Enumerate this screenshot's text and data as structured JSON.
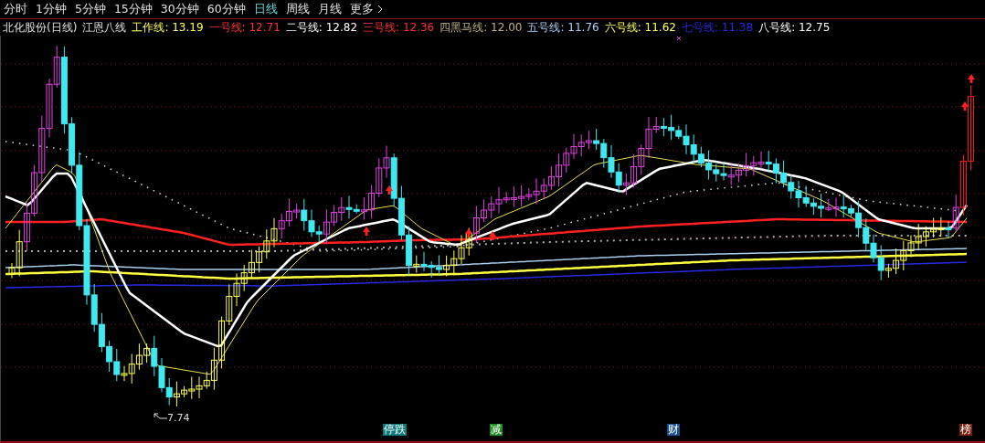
{
  "periods": [
    {
      "label": "分时",
      "selected": false
    },
    {
      "label": "1分钟",
      "selected": false
    },
    {
      "label": "5分钟",
      "selected": false
    },
    {
      "label": "15分钟",
      "selected": false
    },
    {
      "label": "30分钟",
      "selected": false
    },
    {
      "label": "60分钟",
      "selected": false
    },
    {
      "label": "日线",
      "selected": true
    },
    {
      "label": "周线",
      "selected": false
    },
    {
      "label": "月线",
      "selected": false
    },
    {
      "label": "更多",
      "selected": false
    }
  ],
  "legend": {
    "stock": "北化股份(日线)",
    "indicator": "江恩八线",
    "lines": [
      {
        "label": "工作线: 13.19",
        "color": "#ffff54"
      },
      {
        "label": "一号线: 12.71",
        "color": "#ff3030"
      },
      {
        "label": "二号线: 12.82",
        "color": "#ffffff"
      },
      {
        "label": "三号线: 12.36",
        "color": "#ff3030"
      },
      {
        "label": "四黑马线: 12.00",
        "color": "#c0b080"
      },
      {
        "label": "五号线: 11.76",
        "color": "#a8d0f0"
      },
      {
        "label": "六号线: 11.62",
        "color": "#ffff54"
      },
      {
        "label": "七号线: 11.38",
        "color": "#2828e0"
      },
      {
        "label": "八号线: 12.75",
        "color": "#ffffff"
      }
    ]
  },
  "chart": {
    "low_label": "7.74"
  },
  "event_markers": [
    {
      "label": "停跌",
      "color": "#0f7a7a"
    },
    {
      "label": "减",
      "color": "#1f8a1f"
    },
    {
      "label": "财",
      "color": "#1a4f8f"
    },
    {
      "label": "榜",
      "color": "#7a2010"
    }
  ]
}
